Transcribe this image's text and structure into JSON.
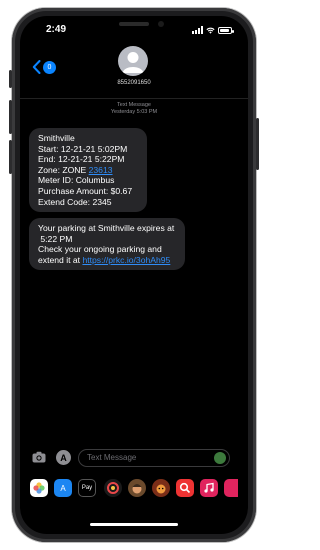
{
  "status": {
    "time": "2:49"
  },
  "header": {
    "contact": "8552091650",
    "back_badge": "0"
  },
  "thread": {
    "meta_line1": "Text Message",
    "meta_line2": "Yesterday 5:03 PM"
  },
  "messages": [
    {
      "lines": [
        "Smithville",
        "Start: 12-21-21 5:02PM",
        "End: 12-21-21 5:22PM",
        "Meter ID: Columbus",
        "Purchase Amount: $0.67",
        "Extend Code: 2345"
      ],
      "zone_prefix": "Zone: ZONE ",
      "zone_number": "23613"
    },
    {
      "line1": "Your parking at Smithville expires at",
      "line2": " 5:22 PM",
      "line3": "Check your ongoing parking and",
      "line4_prefix": "extend it at ",
      "link": "https://prkc.io/3ohAh95"
    }
  ],
  "composer": {
    "placeholder": "Text Message"
  },
  "app_strip": {
    "pay_label": "Pay"
  },
  "colors": {
    "link": "#2f8cf6",
    "bubble": "#262629",
    "accent": "#0a84ff"
  }
}
